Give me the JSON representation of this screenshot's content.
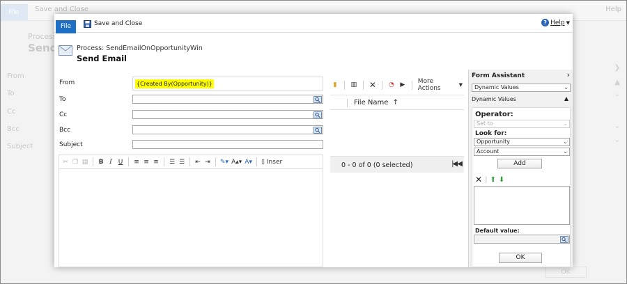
{
  "background": {
    "file_label": "File",
    "save_close_label": "Save and Close",
    "help_label": "Help",
    "process_title": "Process",
    "page_title": "Send",
    "labels": [
      "From",
      "To",
      "Cc",
      "Bcc",
      "Subject"
    ],
    "ok_label": "OK"
  },
  "toolbar": {
    "file_label": "File",
    "save_close_label": "Save and Close",
    "help_label": "Help"
  },
  "header": {
    "process_title": "Process: SendEmailOnOpportunityWin",
    "page_title": "Send Email"
  },
  "form": {
    "from_label": "From",
    "from_value": "{Created By(Opportunity)}",
    "to_label": "To",
    "cc_label": "Cc",
    "bcc_label": "Bcc",
    "subject_label": "Subject"
  },
  "editor": {
    "bold": "B",
    "italic": "I",
    "underline": "U",
    "insert_label": "Inser"
  },
  "attachments": {
    "more_actions_label": "More Actions",
    "file_name_header": "File Name",
    "sort_arrow": "↑",
    "record_count": "0 - 0 of 0 (0 selected)"
  },
  "form_assistant": {
    "title": "Form Assistant",
    "dropdown_value": "Dynamic Values",
    "section_label": "Dynamic Values",
    "operator_label": "Operator:",
    "operator_value": "Set to",
    "look_for_label": "Look for:",
    "look_for_entity": "Opportunity",
    "look_for_field": "Account",
    "add_label": "Add",
    "default_value_label": "Default value:",
    "ok_label": "OK"
  },
  "colors": {
    "accent": "#1f6fc5",
    "highlight": "#ffff00",
    "panel": "#f1f1f1"
  }
}
